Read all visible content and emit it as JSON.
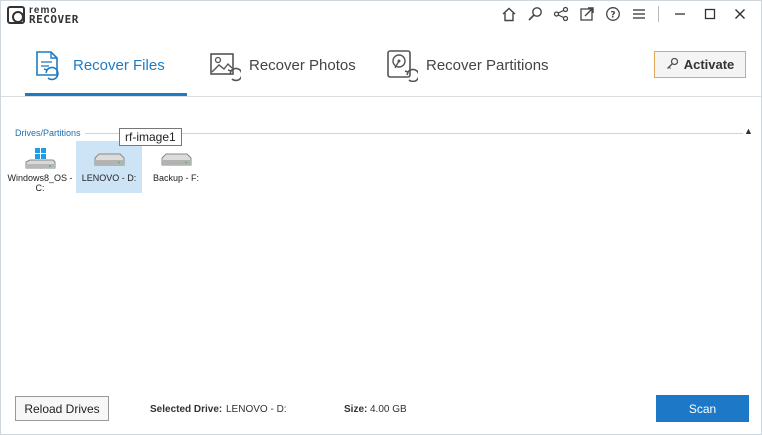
{
  "app": {
    "logo_top": "remo",
    "logo_bottom": "RECOVER"
  },
  "titlebar": {
    "icons": [
      "home-icon",
      "search-icon",
      "share-icon",
      "external-link-icon",
      "help-icon",
      "menu-icon"
    ],
    "window_controls": [
      "minimize",
      "maximize",
      "close"
    ]
  },
  "tabs": [
    {
      "label": "Recover Files",
      "icon": "recover-files-icon",
      "active": true
    },
    {
      "label": "Recover Photos",
      "icon": "recover-photos-icon",
      "active": false
    },
    {
      "label": "Recover Partitions",
      "icon": "recover-partitions-icon",
      "active": false
    }
  ],
  "activate": {
    "label": "Activate",
    "icon": "key-icon"
  },
  "drives_section": {
    "label": "Drives/Partitions",
    "drives": [
      {
        "label": "Windows8_OS - C:",
        "icon": "windows-drive-icon",
        "selected": false
      },
      {
        "label": "LENOVO - D:",
        "icon": "hard-drive-icon",
        "selected": true
      },
      {
        "label": "Backup - F:",
        "icon": "hard-drive-icon",
        "selected": false
      }
    ],
    "tooltip": "rf-image1"
  },
  "footer": {
    "reload_label": "Reload Drives",
    "selected_drive_label": "Selected Drive:",
    "selected_drive_value": "LENOVO - D:",
    "size_label": "Size:",
    "size_value": "4.00 GB",
    "scan_label": "Scan"
  },
  "colors": {
    "accent": "#1f7bc2",
    "scan_button": "#1e78c8",
    "selected_drive_bg": "#cde4f7",
    "activate_border": "#e0a85a"
  }
}
